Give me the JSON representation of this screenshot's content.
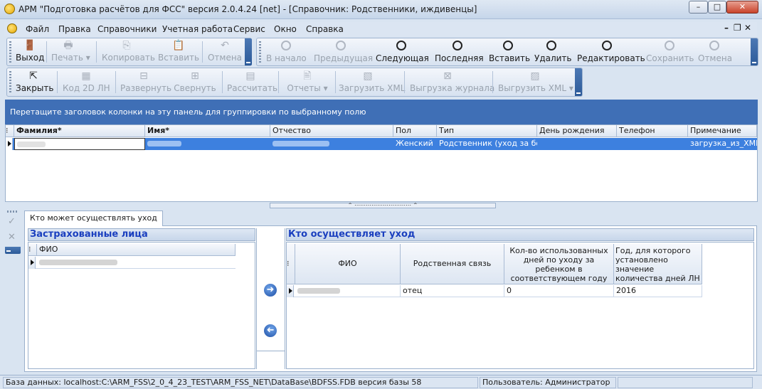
{
  "window": {
    "title": "АРМ \"Подготовка расчётов для ФСС\"  версия 2.0.4.24 [net] - [Справочник: Родственники, иждивенцы]",
    "controls": {
      "minimize": "–",
      "maximize": "□",
      "close": "✕"
    }
  },
  "menu": {
    "items": [
      "Файл",
      "Правка",
      "Справочники",
      "Учетная работа",
      "Сервис",
      "Окно",
      "Справка"
    ],
    "mdi_controls": {
      "minimize": "–",
      "restore": "❐",
      "close": "✕"
    }
  },
  "toolbar1": {
    "exit": "Выход",
    "print": "Печать",
    "copy": "Копировать",
    "paste": "Вставить",
    "cancel": "Отмена"
  },
  "toolbar2": {
    "first": "В начало",
    "prev": "Предыдущая",
    "next": "Следующая",
    "last": "Последняя",
    "insert": "Вставить",
    "delete": "Удалить",
    "edit": "Редактировать",
    "save": "Сохранить",
    "cancel": "Отмена"
  },
  "toolbar3": {
    "close": "Закрыть",
    "code2d": "Код 2D  ЛН",
    "expand": "Развернуть",
    "collapse": "Свернуть",
    "calculate": "Рассчитать",
    "reports": "Отчеты",
    "load_xml": "Загрузить XML",
    "export_journal": "Выгрузка журнала",
    "export_xml": "Выгрузить XML"
  },
  "group_panel": {
    "hint": "Перетащите заголовок колонки на эту панель для группировки по выбранному полю"
  },
  "main_grid": {
    "columns": [
      "Фамилия*",
      "Имя*",
      "Отчество",
      "Пол",
      "Тип",
      "День рождения",
      "Телефон",
      "Примечание"
    ],
    "rows": [
      {
        "lastname": "",
        "firstname": "",
        "patronymic": "",
        "gender": "Женский",
        "type": "Родственник (уход за бол",
        "birthday": "",
        "phone": "",
        "note": "загрузка_из_XML~"
      }
    ]
  },
  "detail": {
    "tab_label": "Кто может осуществлять уход",
    "insured": {
      "title": "Застрахованные лица",
      "column": "ФИО",
      "rows": [
        {
          "fio": ""
        }
      ]
    },
    "caregiver": {
      "title": "Кто осуществляет уход",
      "columns": {
        "fio": "ФИО",
        "relation": "Родственная связь",
        "days": "Кол-во использованных дней по уходу за ребенком в соответствующем году до начала пилотного проекта",
        "year": "Год, для которого установлено значение количества дней ЛН до пилотного проекта"
      },
      "rows": [
        {
          "fio": "",
          "relation": "отец",
          "days": "0",
          "year": "2016"
        }
      ]
    },
    "side_icons": {
      "confirm": "✓",
      "reject": "✕"
    }
  },
  "status_bar": {
    "database": "База данных: localhost:C:\\ARM_FSS\\2_0_4_23_TEST\\ARM_FSS_NET\\DataBase\\BDFSS.FDB   версия базы 58",
    "user": "Пользователь: Администратор"
  },
  "colors": {
    "group_panel": "#3f6fb6",
    "selected_row": "#3d80df",
    "header_text": "#1a3fbf"
  },
  "icons": {
    "exit": "door-icon",
    "print": "printer-icon",
    "copy": "copy-icon",
    "paste": "paste-icon",
    "cancel": "undo-icon",
    "first": "first-record-icon",
    "prev": "prev-record-icon",
    "next": "next-record-icon",
    "last": "last-record-icon",
    "insert": "plus-circle-icon",
    "delete": "minus-circle-icon",
    "edit": "pencil-circle-icon",
    "save": "check-circle-icon",
    "abort": "x-circle-icon",
    "move_right": "arrow-right-icon",
    "move_left": "arrow-left-icon"
  }
}
